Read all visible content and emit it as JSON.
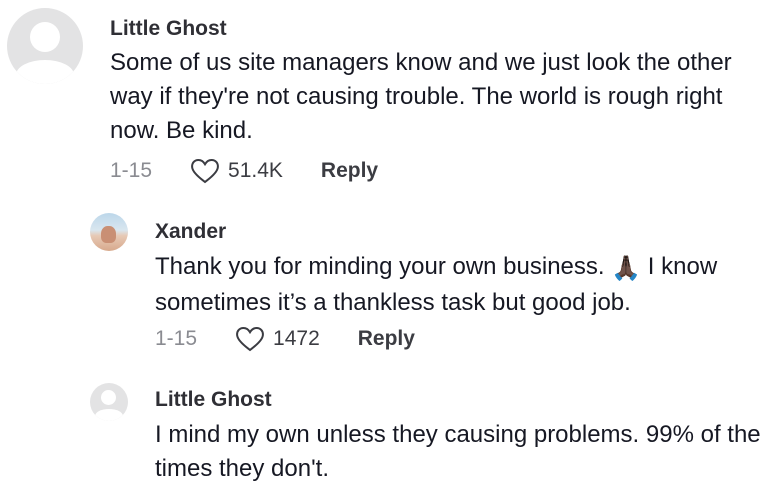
{
  "comments": [
    {
      "username": "Little Ghost",
      "text": "Some of us site managers know and we just look the other way if they're not causing trouble. The world is rough right now. Be kind.",
      "date": "1-15",
      "likes": "51.4K",
      "reply_label": "Reply",
      "avatar": "default-avatar-icon"
    },
    {
      "username": "Xander",
      "text_before": "Thank you for minding your own business. ",
      "emoji": "🙏🏿",
      "text_after": " I know sometimes it’s a thankless task but good job.",
      "date": "1-15",
      "likes": "1472",
      "reply_label": "Reply",
      "avatar": "profile-photo"
    },
    {
      "username": "Little Ghost",
      "text": "I mind my own unless they causing problems. 99% of the times they don't.",
      "avatar": "default-avatar-icon"
    }
  ],
  "colors": {
    "username": "#2f2f35",
    "text": "#161823",
    "meta": "#8a8b91",
    "avatar_bg": "#e3e3e4"
  }
}
